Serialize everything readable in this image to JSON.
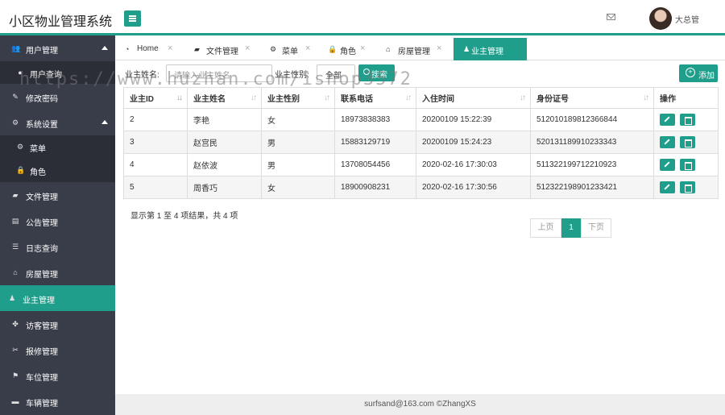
{
  "app": {
    "title": "小区物业管理系统",
    "user": "大总管"
  },
  "sidebar": {
    "items": [
      {
        "label": "用户管理",
        "icon": "users-icon",
        "glyph": "👥"
      },
      {
        "label": "用户查询",
        "icon": "user-icon",
        "glyph": "●"
      },
      {
        "label": "修改密码",
        "icon": "edit-icon",
        "glyph": "✎"
      },
      {
        "label": "系统设置",
        "icon": "cogs-icon",
        "glyph": "⚙"
      },
      {
        "label": "菜单",
        "icon": "gear-icon",
        "glyph": "⚙"
      },
      {
        "label": "角色",
        "icon": "lock-icon",
        "glyph": "🔒"
      },
      {
        "label": "文件管理",
        "icon": "folder-icon",
        "glyph": "▰"
      },
      {
        "label": "公告管理",
        "icon": "book-icon",
        "glyph": "▤"
      },
      {
        "label": "日志查询",
        "icon": "list-icon",
        "glyph": "☰"
      },
      {
        "label": "房屋管理",
        "icon": "bank-icon",
        "glyph": "⌂"
      },
      {
        "label": "业主管理",
        "icon": "male-icon",
        "glyph": "♟"
      },
      {
        "label": "访客管理",
        "icon": "paw-icon",
        "glyph": "✤"
      },
      {
        "label": "报修管理",
        "icon": "wrench-icon",
        "glyph": "✂"
      },
      {
        "label": "车位管理",
        "icon": "flag-icon",
        "glyph": "⚑"
      },
      {
        "label": "车辆管理",
        "icon": "car-icon",
        "glyph": "▬"
      }
    ]
  },
  "tabs": [
    {
      "label": "Home",
      "icon": "dashboard-icon",
      "glyph": "◔"
    },
    {
      "label": "文件管理",
      "icon": "folder-icon",
      "glyph": "▰"
    },
    {
      "label": "菜单",
      "icon": "gear-icon",
      "glyph": "⚙"
    },
    {
      "label": "角色",
      "icon": "lock-icon",
      "glyph": "🔒"
    },
    {
      "label": "房屋管理",
      "icon": "bank-icon",
      "glyph": "⌂"
    },
    {
      "label": "业主管理",
      "icon": "male-icon",
      "glyph": "♟"
    }
  ],
  "tab_close_glyph": "×",
  "filter": {
    "name_label": "业主姓名:",
    "name_placeholder": "请输入业主姓名",
    "gender_label": "业主性别:",
    "gender_value": "全部",
    "search_label": "搜索",
    "add_label": "添加"
  },
  "table": {
    "headers": [
      "业主ID",
      "业主姓名",
      "业主性别",
      "联系电话",
      "入住时间",
      "身份证号",
      "操作"
    ],
    "rows": [
      [
        "2",
        "李艳",
        "女",
        "18973838383",
        "20200109 15:22:39",
        "512010189812366844"
      ],
      [
        "3",
        "赵宫民",
        "男",
        "15883129719",
        "20200109 15:24:23",
        "520131189910233343"
      ],
      [
        "4",
        "赵依波",
        "男",
        "13708054456",
        "2020-02-16 17:30:03",
        "511322199712210923"
      ],
      [
        "5",
        "周香巧",
        "女",
        "18900908231",
        "2020-02-16 17:30:56",
        "512322198901233421"
      ]
    ]
  },
  "summary": "显示第 1 至 4 项结果，共 4 项",
  "pager": {
    "prev": "上页",
    "current": "1",
    "next": "下页"
  },
  "footer": "surfsand@163.com ©ZhangXS",
  "watermark": "https://www.huzhan.com/ishop3572",
  "colors": {
    "accent": "#1e9e8b",
    "sidebar": "#393d49"
  }
}
